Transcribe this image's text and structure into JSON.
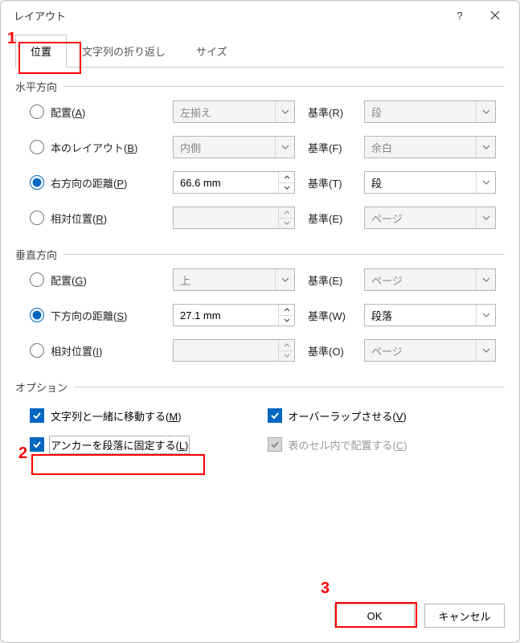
{
  "dialog": {
    "title": "レイアウト"
  },
  "callouts": {
    "one": "1",
    "two": "2",
    "three": "3"
  },
  "tabs": {
    "position": "位置",
    "wrap": "文字列の折り返し",
    "size": "サイズ"
  },
  "groups": {
    "horizontal": "水平方向",
    "vertical": "垂直方向",
    "options": "オプション"
  },
  "h": {
    "align": {
      "label_pre": "配置(",
      "label_ul": "A",
      "label_post": ")",
      "value": "左揃え",
      "ref_label_pre": "基準(",
      "ref_label_ul": "R",
      "ref_label_post": ")",
      "ref_value": "段"
    },
    "book": {
      "label_pre": "本のレイアウト(",
      "label_ul": "B",
      "label_post": ")",
      "value": "内側",
      "ref_label_pre": "基準(",
      "ref_label_ul": "F",
      "ref_label_post": ")",
      "ref_value": "余白"
    },
    "abs": {
      "label_pre": "右方向の距離(",
      "label_ul": "P",
      "label_post": ")",
      "value": "66.6 mm",
      "ref_label_pre": "基準(",
      "ref_label_ul": "T",
      "ref_label_post": ")",
      "ref_value": "段"
    },
    "rel": {
      "label_pre": "相対位置(",
      "label_ul": "R",
      "label_post": ")",
      "value": "",
      "ref_label_pre": "基準(",
      "ref_label_ul": "E",
      "ref_label_post": ")",
      "ref_value": "ページ"
    }
  },
  "v": {
    "align": {
      "label_pre": "配置(",
      "label_ul": "G",
      "label_post": ")",
      "value": "上",
      "ref_label_pre": "基準(",
      "ref_label_ul": "E",
      "ref_label_post": ")",
      "ref_value": "ページ"
    },
    "abs": {
      "label_pre": "下方向の距離(",
      "label_ul": "S",
      "label_post": ")",
      "value": "27.1 mm",
      "ref_label_pre": "基準(",
      "ref_label_ul": "W",
      "ref_label_post": ")",
      "ref_value": "段落"
    },
    "rel": {
      "label_pre": "相対位置(",
      "label_ul": "I",
      "label_post": ")",
      "value": "",
      "ref_label_pre": "基準(",
      "ref_label_ul": "O",
      "ref_label_post": ")",
      "ref_value": "ページ"
    }
  },
  "opts": {
    "move": {
      "pre": "文字列と一緒に移動する(",
      "ul": "M",
      "post": ")"
    },
    "lock": {
      "pre": "アンカーを段落に固定する(",
      "ul": "L",
      "post": ")"
    },
    "overlap": {
      "pre": "オーバーラップさせる(",
      "ul": "V",
      "post": ")"
    },
    "cell": {
      "pre": "表のセル内で配置する(",
      "ul": "C",
      "post": ")"
    }
  },
  "buttons": {
    "ok": "OK",
    "cancel": "キャンセル"
  }
}
